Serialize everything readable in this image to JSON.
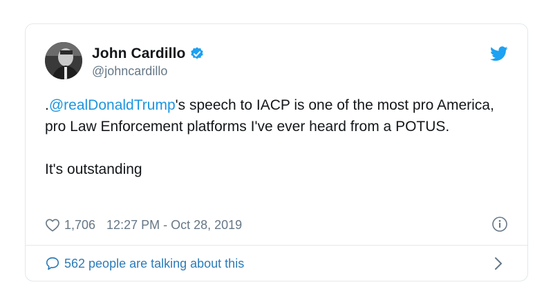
{
  "tweet": {
    "display_name": "John Cardillo",
    "handle": "@johncardillo",
    "text_prefix": ".",
    "mention": "@realDonaldTrump",
    "text_rest": "'s speech to IACP is one of the most pro America, pro Law Enforcement platforms I've ever heard from a POTUS.",
    "text_second": "It's outstanding",
    "likes": "1,706",
    "timestamp": "12:27 PM - Oct 28, 2019",
    "talking": "562 people are talking about this"
  },
  "icons": {
    "verified": "verified-badge-icon",
    "bird": "twitter-bird-icon",
    "heart": "heart-icon",
    "info": "info-icon",
    "bubble": "speech-bubble-icon",
    "chevron": "chevron-right-icon"
  },
  "colors": {
    "link": "#1b95e0",
    "muted": "#657786",
    "accent": "#1da1f2",
    "talking": "#2b7bb9"
  }
}
